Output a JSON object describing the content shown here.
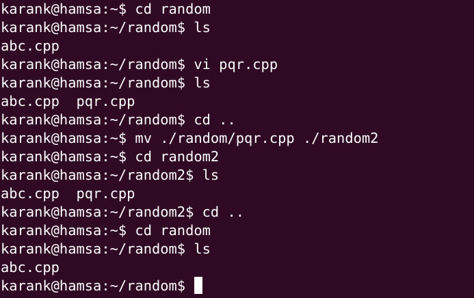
{
  "terminal": {
    "lines": [
      "karank@hamsa:~$ cd random",
      "karank@hamsa:~/random$ ls",
      "abc.cpp",
      "karank@hamsa:~/random$ vi pqr.cpp",
      "karank@hamsa:~/random$ ls",
      "abc.cpp  pqr.cpp",
      "karank@hamsa:~/random$ cd ..",
      "karank@hamsa:~$ mv ./random/pqr.cpp ./random2",
      "karank@hamsa:~$ cd random2",
      "karank@hamsa:~/random2$ ls",
      "abc.cpp  pqr.cpp",
      "karank@hamsa:~/random2$ cd ..",
      "karank@hamsa:~$ cd random",
      "karank@hamsa:~/random$ ls",
      "abc.cpp",
      "karank@hamsa:~/random$ "
    ]
  },
  "colors": {
    "background": "#300a24",
    "foreground": "#ffffff",
    "cursor": "#ffffff"
  },
  "icons": {
    "cursor": "block-cursor-icon"
  }
}
